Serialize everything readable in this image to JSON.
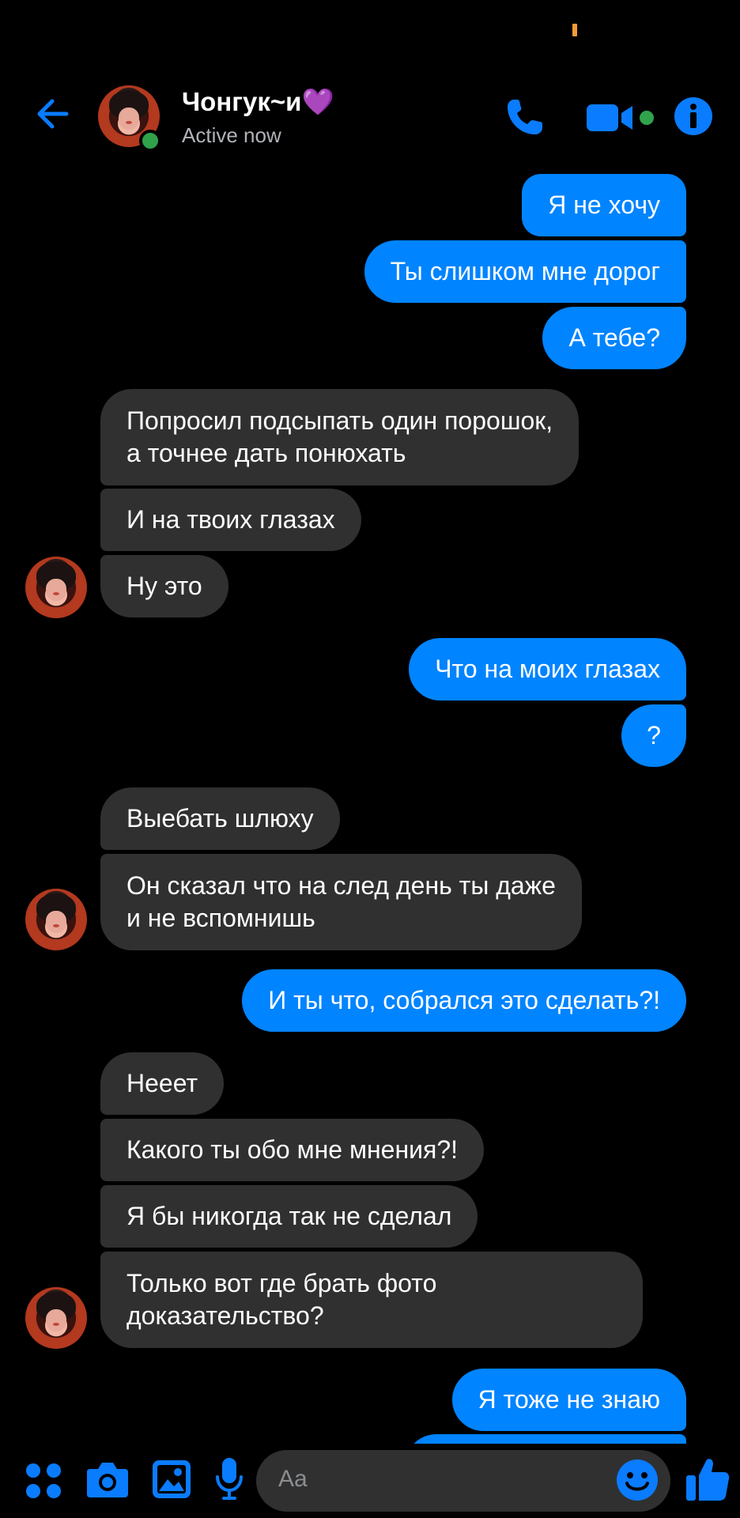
{
  "header": {
    "contact_name": "Чонгук~и💜",
    "status": "Active now"
  },
  "messages": [
    {
      "side": "out",
      "text": "Я не хочу"
    },
    {
      "side": "out",
      "text": "Ты слишком мне дорог"
    },
    {
      "side": "out",
      "text": "А тебе?"
    },
    {
      "side": "in",
      "text": "Попросил подсыпать один порошок,\nа точнее дать понюхать"
    },
    {
      "side": "in",
      "text": "И на твоих глазах"
    },
    {
      "side": "in",
      "text": "Ну это"
    },
    {
      "side": "out",
      "text": "Что на моих глазах"
    },
    {
      "side": "out",
      "text": "?"
    },
    {
      "side": "in",
      "text": "Выебать шлюху"
    },
    {
      "side": "in",
      "text": "Он сказал что на след день ты даже\nи не вспомнишь"
    },
    {
      "side": "out",
      "text": "И ты что, собрался это сделать?!"
    },
    {
      "side": "in",
      "text": "Нееет"
    },
    {
      "side": "in",
      "text": "Какого ты обо мне мнения?!"
    },
    {
      "side": "in",
      "text": "Я бы никогда так не сделал"
    },
    {
      "side": "in",
      "text": "Только вот где брать фото\nдоказательство?"
    },
    {
      "side": "out",
      "text": "Я тоже не знаю"
    }
  ],
  "composer": {
    "placeholder": "Aa",
    "icons": [
      "apps-icon",
      "camera-icon",
      "gallery-icon",
      "microphone-icon",
      "emoji-icon",
      "thumbs-up-icon"
    ]
  },
  "colors": {
    "accent": "#0084ff",
    "incoming_bubble": "#303030",
    "online": "#31a24c"
  }
}
